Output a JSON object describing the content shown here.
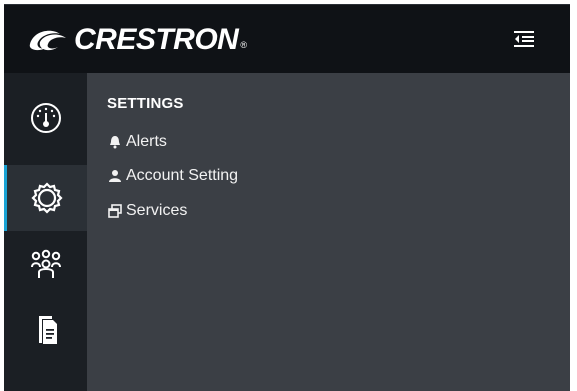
{
  "header": {
    "brand": "CRESTRON",
    "trademark": "®",
    "menu_icon": "collapse-menu-icon"
  },
  "rail": {
    "items": [
      {
        "icon": "dashboard-gauge-icon",
        "active": false
      },
      {
        "icon": "settings-gear-icon",
        "active": true
      },
      {
        "icon": "users-group-icon",
        "active": false
      },
      {
        "icon": "documents-icon",
        "active": false
      }
    ]
  },
  "settings_panel": {
    "title": "SETTINGS",
    "items": [
      {
        "icon": "bell-icon",
        "label": "Alerts"
      },
      {
        "icon": "user-icon",
        "label": "Account Setting"
      },
      {
        "icon": "windows-icon",
        "label": "Services"
      }
    ]
  },
  "colors": {
    "header_bg": "#0f1216",
    "rail_bg": "#1b1f24",
    "rail_active_bg": "#2b3036",
    "rail_active_accent": "#1aa3d4",
    "panel_bg": "#3b3f45",
    "text": "#ffffff"
  }
}
